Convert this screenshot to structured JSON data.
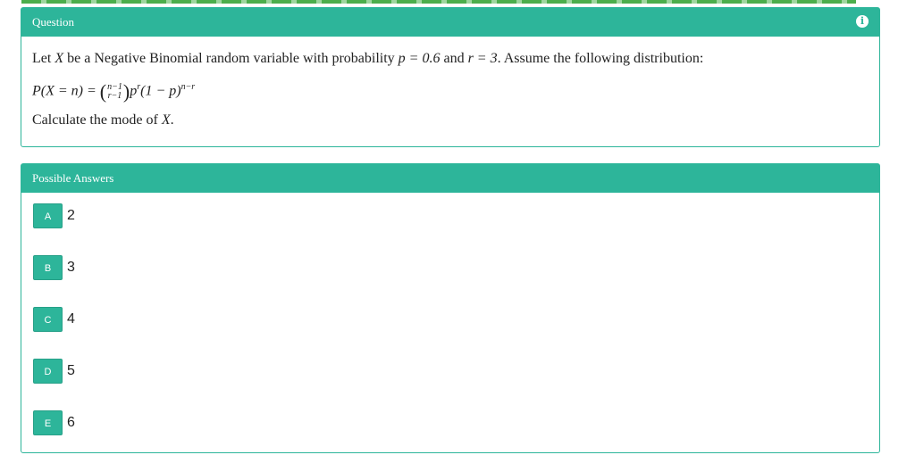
{
  "question_panel": {
    "title": "Question",
    "info_icon": "info-icon",
    "text_intro": "Let",
    "var_x": "X",
    "text_middle": "be a Negative Binomial random variable with probability",
    "p_expr": "p = 0.6",
    "text_and": "and",
    "r_expr": "r = 3",
    "text_end": ". Assume the following distribution:",
    "formula_lhs": "P(X = n) =",
    "binom_top": "n−1",
    "binom_bottom": "r−1",
    "formula_p": "p",
    "formula_p_exp": "r",
    "formula_rest": "(1 − p)",
    "formula_rest_exp": "n−r",
    "instruction_prefix": "Calculate the mode of",
    "instruction_var": "X",
    "instruction_suffix": "."
  },
  "answers_panel": {
    "title": "Possible Answers",
    "options": [
      {
        "letter": "A",
        "value": "2"
      },
      {
        "letter": "B",
        "value": "3"
      },
      {
        "letter": "C",
        "value": "4"
      },
      {
        "letter": "D",
        "value": "5"
      },
      {
        "letter": "E",
        "value": "6"
      }
    ]
  },
  "colors": {
    "accent": "#2db59a",
    "progress": "#4cae4c"
  }
}
